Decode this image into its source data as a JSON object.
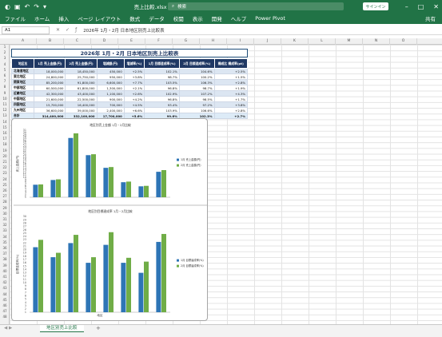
{
  "window": {
    "title": "売上比較.xlsx - Excel",
    "search_label": "検索",
    "signin_label": "サインイン"
  },
  "ribbon": {
    "tabs": [
      "ファイル",
      "ホーム",
      "挿入",
      "ページ レイアウト",
      "数式",
      "データ",
      "校閲",
      "表示",
      "開発",
      "ヘルプ",
      "Power Pivot"
    ],
    "share_label": "共有"
  },
  "formula": {
    "name_box": "A1",
    "content": "2026年 1月・2月 日本地区別売上比較表"
  },
  "columns": [
    "A",
    "B",
    "C",
    "D",
    "E",
    "F",
    "G",
    "H",
    "I",
    "J",
    "K",
    "L",
    "M",
    "N",
    "O"
  ],
  "rows": [
    "1",
    "2",
    "3",
    "4",
    "5",
    "6",
    "7",
    "8",
    "9",
    "10",
    "11",
    "12",
    "13",
    "14",
    "15",
    "16",
    "17",
    "18",
    "19",
    "20",
    "21",
    "22",
    "23",
    "24",
    "25",
    "26",
    "27",
    "28",
    "29",
    "30",
    "31",
    "32",
    "33",
    "34",
    "35",
    "36",
    "37",
    "38",
    "39",
    "40",
    "41",
    "42",
    "43",
    "44",
    "45",
    "46",
    "47",
    "48"
  ],
  "table": {
    "title": "2026年 1月・2月 日本地区別売上比較表",
    "headers": [
      "地区名",
      "1月 売上金額(円)",
      "2月 売上金額(円)",
      "増減額(円)",
      "増減率(%)",
      "1月 目標達成率(%)",
      "2月 目標達成率(%)",
      "構成比 構成率(pt)"
    ],
    "rows": [
      [
        "北海道地区",
        "18,000,000",
        "18,450,000",
        "450,000",
        "+2.5%",
        "102.1%",
        "104.6%",
        "+2.5%"
      ],
      [
        "東北地区",
        "24,800,000",
        "25,750,000",
        "950,000",
        "+3.8%",
        "98.7%",
        "100.2%",
        "+1.5%"
      ],
      [
        "関東地区",
        "85,200,000",
        "91,800,000",
        "6,600,000",
        "+7.7%",
        "103.5%",
        "106.3%",
        "+2.8%"
      ],
      [
        "中部地区",
        "60,500,000",
        "61,800,000",
        "1,300,000",
        "+2.1%",
        "96.8%",
        "98.7%",
        "+1.9%"
      ],
      [
        "近畿地区",
        "42,300,000",
        "43,400,000",
        "1,100,000",
        "+2.6%",
        "102.9%",
        "107.2%",
        "+4.3%"
      ],
      [
        "中国地区",
        "21,600,000",
        "22,500,000",
        "900,000",
        "+4.2%",
        "96.8%",
        "98.5%",
        "+1.7%"
      ],
      [
        "四国地区",
        "15,700,000",
        "16,400,000",
        "700,000",
        "+4.5%",
        "93.4%",
        "97.2%",
        "+3.8%"
      ],
      [
        "九州地区",
        "36,600,000",
        "39,000,000",
        "2,400,000",
        "+6.6%",
        "103.9%",
        "106.6%",
        "+2.8%"
      ]
    ],
    "total": [
      "合計",
      "314,400,000",
      "332,100,000",
      "17,700,000",
      "+5.6%",
      "99.6%",
      "102.3%",
      "+2.7%"
    ]
  },
  "chart_data": [
    {
      "type": "bar",
      "title": "地区別売上金額 1月・2月比較",
      "xlabel": "",
      "ylabel": "売上金額(円)",
      "categories": [
        "北海道地区",
        "東北地区",
        "関東地区",
        "中部地区",
        "近畿地区",
        "中国地区",
        "四国地区",
        "九州地区"
      ],
      "series": [
        {
          "name": "1月 売上金額(円)",
          "values": [
            18000000,
            24800000,
            85200000,
            60500000,
            42300000,
            21600000,
            15700000,
            36600000
          ]
        },
        {
          "name": "2月 売上金額(円)",
          "values": [
            18450000,
            25750000,
            91800000,
            61800000,
            43400000,
            22500000,
            16400000,
            39000000
          ]
        }
      ],
      "axis_labels": [
        "31",
        "30",
        "29",
        "28",
        "27",
        "26",
        "25",
        "24",
        "23",
        "22",
        "21",
        "20",
        "19",
        "18",
        "17",
        "16",
        "15",
        "14",
        "13",
        "12",
        "11",
        "10",
        "9",
        "8",
        "7",
        "6",
        "5",
        "4",
        "3",
        "2",
        "1"
      ],
      "colors": [
        "#2e75b6",
        "#70ad47"
      ],
      "legend": "right"
    },
    {
      "type": "bar",
      "title": "地区別目標達成率 1月・2月比較",
      "xlabel": "地区",
      "ylabel": "目標達成率(%)",
      "categories": [
        "北海道地区",
        "東北地区",
        "関東地区",
        "中部地区",
        "近畿地区",
        "中国地区",
        "四国地区",
        "九州地区"
      ],
      "series": [
        {
          "name": "1月 目標達成率(%)",
          "values": [
            102.1,
            98.7,
            103.5,
            96.8,
            102.9,
            96.8,
            93.4,
            103.9
          ]
        },
        {
          "name": "2月 目標達成率(%)",
          "values": [
            104.6,
            100.2,
            106.3,
            98.7,
            107.2,
            98.5,
            97.2,
            106.6
          ]
        }
      ],
      "axis_labels": [
        "30",
        "29",
        "28",
        "27",
        "26",
        "25",
        "24",
        "23",
        "22",
        "21",
        "20",
        "19",
        "18",
        "17",
        "16",
        "15",
        "14",
        "13",
        "12",
        "11",
        "10",
        "9",
        "8",
        "7",
        "6",
        "5",
        "4",
        "3",
        "2",
        "1"
      ],
      "colors": [
        "#2e75b6",
        "#70ad47"
      ],
      "legend": "right"
    }
  ],
  "sheet": {
    "active_tab": "地区別売上比較",
    "add_label": "+"
  }
}
